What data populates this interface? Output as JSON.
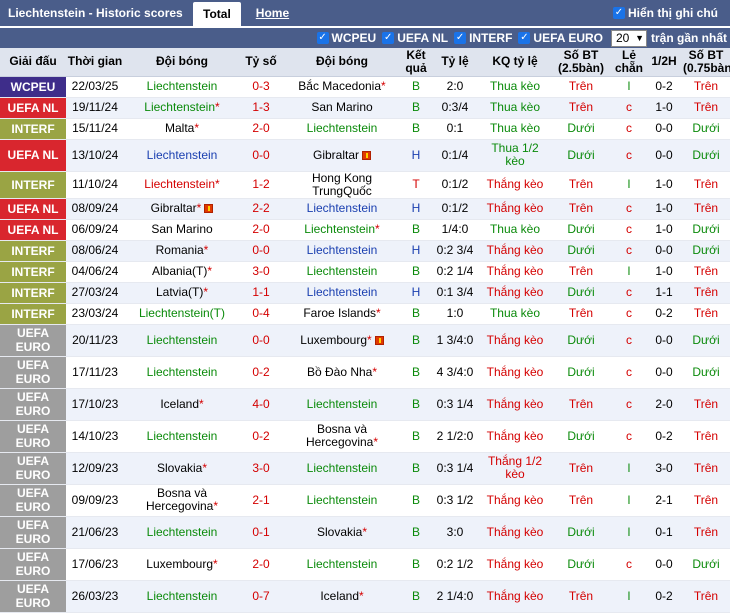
{
  "header": {
    "title": "Liechtenstein - Historic scores",
    "tab_total": "Total",
    "tab_home": "Home",
    "show_recent": "Hiển thị ghi chú"
  },
  "filters": {
    "items": [
      "WCPEU",
      "UEFA NL",
      "INTERF",
      "UEFA EURO"
    ],
    "count_value": "20",
    "recent_label": "trận gần nhất"
  },
  "columns": [
    "Giải đấu",
    "Thời gian",
    "Đội bóng",
    "Tỷ số",
    "Đội bóng",
    "Kết quả",
    "Tỷ lệ",
    "KQ tỷ lệ",
    "Số BT (2.5bàn)",
    "Lẻ chẵn",
    "1/2H",
    "Số BT (0.75bàn)"
  ],
  "colors": {
    "WCPEU": "#3e2d8a",
    "UEFA NL": "#d9262e",
    "INTERF": "#9aa444",
    "UEFA EURO": "#9e9e9e",
    "win": "#0a8a0a",
    "lose": "#d40000",
    "header_bg": "#4a5d8a"
  },
  "rows": [
    {
      "league": "WCPEU",
      "date": "22/03/25",
      "home": "Liechtenstein",
      "home_star": false,
      "home_color": "green",
      "score": "0-3",
      "away": "Bắc Macedonia",
      "away_star": true,
      "away_color": "black",
      "result": "B",
      "odds": "2:0",
      "odds_result": "Thua kèo",
      "ou": "Trên",
      "oe": "l",
      "half": "0-2",
      "ou2": "Trên"
    },
    {
      "league": "UEFA NL",
      "date": "19/11/24",
      "home": "Liechtenstein",
      "home_star": true,
      "home_color": "green",
      "score": "1-3",
      "away": "San Marino",
      "away_star": false,
      "away_color": "black",
      "result": "B",
      "odds": "0:3/4",
      "odds_result": "Thua kèo",
      "ou": "Trên",
      "oe": "c",
      "half": "1-0",
      "ou2": "Trên"
    },
    {
      "league": "INTERF",
      "date": "15/11/24",
      "home": "Malta",
      "home_star": true,
      "home_color": "black",
      "score": "2-0",
      "away": "Liechtenstein",
      "away_star": false,
      "away_color": "green",
      "result": "B",
      "odds": "0:1",
      "odds_result": "Thua kèo",
      "ou": "Dưới",
      "oe": "c",
      "half": "0-0",
      "ou2": "Dưới"
    },
    {
      "league": "UEFA NL",
      "date": "13/10/24",
      "home": "Liechtenstein",
      "home_star": false,
      "home_color": "blue",
      "score": "0-0",
      "away": "Gibraltar",
      "away_star": false,
      "away_flag": true,
      "away_color": "black",
      "result": "H",
      "odds": "0:1/4",
      "odds_result": "Thua 1/2 kèo",
      "ou": "Dưới",
      "oe": "c",
      "half": "0-0",
      "ou2": "Dưới"
    },
    {
      "league": "INTERF",
      "date": "11/10/24",
      "home": "Liechtenstein",
      "home_star": true,
      "home_color": "red",
      "score": "1-2",
      "away": "Hong Kong TrungQuốc",
      "away_star": false,
      "away_color": "black",
      "result": "T",
      "odds": "0:1/2",
      "odds_result": "Thắng kèo",
      "ou": "Trên",
      "oe": "l",
      "half": "1-0",
      "ou2": "Trên"
    },
    {
      "league": "UEFA NL",
      "date": "08/09/24",
      "home": "Gibraltar",
      "home_star": true,
      "home_flag": true,
      "home_color": "black",
      "score": "2-2",
      "away": "Liechtenstein",
      "away_star": false,
      "away_color": "blue",
      "result": "H",
      "odds": "0:1/2",
      "odds_result": "Thắng kèo",
      "ou": "Trên",
      "oe": "c",
      "half": "1-0",
      "ou2": "Trên"
    },
    {
      "league": "UEFA NL",
      "date": "06/09/24",
      "home": "San Marino",
      "home_star": false,
      "home_color": "black",
      "score": "2-0",
      "away": "Liechtenstein",
      "away_star": true,
      "away_color": "green",
      "result": "B",
      "odds": "1/4:0",
      "odds_result": "Thua kèo",
      "ou": "Dưới",
      "oe": "c",
      "half": "1-0",
      "ou2": "Dưới"
    },
    {
      "league": "INTERF",
      "date": "08/06/24",
      "home": "Romania",
      "home_star": true,
      "home_color": "black",
      "score": "0-0",
      "away": "Liechtenstein",
      "away_star": false,
      "away_color": "blue",
      "result": "H",
      "odds": "0:2 3/4",
      "odds_result": "Thắng kèo",
      "ou": "Dưới",
      "oe": "c",
      "half": "0-0",
      "ou2": "Dưới"
    },
    {
      "league": "INTERF",
      "date": "04/06/24",
      "home": "Albania(T)",
      "home_star": true,
      "home_color": "black",
      "score": "3-0",
      "away": "Liechtenstein",
      "away_star": false,
      "away_color": "green",
      "result": "B",
      "odds": "0:2 1/4",
      "odds_result": "Thắng kèo",
      "ou": "Trên",
      "oe": "l",
      "half": "1-0",
      "ou2": "Trên"
    },
    {
      "league": "INTERF",
      "date": "27/03/24",
      "home": "Latvia(T)",
      "home_star": true,
      "home_color": "black",
      "score": "1-1",
      "away": "Liechtenstein",
      "away_star": false,
      "away_color": "blue",
      "result": "H",
      "odds": "0:1 3/4",
      "odds_result": "Thắng kèo",
      "ou": "Dưới",
      "oe": "c",
      "half": "1-1",
      "ou2": "Trên"
    },
    {
      "league": "INTERF",
      "date": "23/03/24",
      "home": "Liechtenstein(T)",
      "home_star": false,
      "home_color": "green",
      "score": "0-4",
      "away": "Faroe Islands",
      "away_star": true,
      "away_color": "black",
      "result": "B",
      "odds": "1:0",
      "odds_result": "Thua kèo",
      "ou": "Trên",
      "oe": "c",
      "half": "0-2",
      "ou2": "Trên"
    },
    {
      "league": "UEFA EURO",
      "date": "20/11/23",
      "home": "Liechtenstein",
      "home_star": false,
      "home_color": "green",
      "score": "0-0",
      "away": "Luxembourg",
      "away_star": true,
      "away_flag": true,
      "away_color": "black",
      "result": "B",
      "odds": "1 3/4:0",
      "odds_result": "Thắng kèo",
      "ou": "Dưới",
      "oe": "c",
      "half": "0-0",
      "ou2": "Dưới"
    },
    {
      "league": "UEFA EURO",
      "date": "17/11/23",
      "home": "Liechtenstein",
      "home_star": false,
      "home_color": "green",
      "score": "0-2",
      "away": "Bồ Đào Nha",
      "away_star": true,
      "away_color": "black",
      "result": "B",
      "odds": "4 3/4:0",
      "odds_result": "Thắng kèo",
      "ou": "Dưới",
      "oe": "c",
      "half": "0-0",
      "ou2": "Dưới"
    },
    {
      "league": "UEFA EURO",
      "date": "17/10/23",
      "home": "Iceland",
      "home_star": true,
      "home_color": "black",
      "score": "4-0",
      "away": "Liechtenstein",
      "away_star": false,
      "away_color": "green",
      "result": "B",
      "odds": "0:3 1/4",
      "odds_result": "Thắng kèo",
      "ou": "Trên",
      "oe": "c",
      "half": "2-0",
      "ou2": "Trên"
    },
    {
      "league": "UEFA EURO",
      "date": "14/10/23",
      "home": "Liechtenstein",
      "home_star": false,
      "home_color": "green",
      "score": "0-2",
      "away": "Bosna và Hercegovina",
      "away_star": true,
      "away_color": "black",
      "result": "B",
      "odds": "2 1/2:0",
      "odds_result": "Thắng kèo",
      "ou": "Dưới",
      "oe": "c",
      "half": "0-2",
      "ou2": "Trên"
    },
    {
      "league": "UEFA EURO",
      "date": "12/09/23",
      "home": "Slovakia",
      "home_star": true,
      "home_color": "black",
      "score": "3-0",
      "away": "Liechtenstein",
      "away_star": false,
      "away_color": "green",
      "result": "B",
      "odds": "0:3 1/4",
      "odds_result": "Thắng 1/2 kèo",
      "ou": "Trên",
      "oe": "l",
      "half": "3-0",
      "ou2": "Trên"
    },
    {
      "league": "UEFA EURO",
      "date": "09/09/23",
      "home": "Bosna và Hercegovina",
      "home_star": true,
      "home_color": "black",
      "score": "2-1",
      "away": "Liechtenstein",
      "away_star": false,
      "away_color": "green",
      "result": "B",
      "odds": "0:3 1/2",
      "odds_result": "Thắng kèo",
      "ou": "Trên",
      "oe": "l",
      "half": "2-1",
      "ou2": "Trên"
    },
    {
      "league": "UEFA EURO",
      "date": "21/06/23",
      "home": "Liechtenstein",
      "home_star": false,
      "home_color": "green",
      "score": "0-1",
      "away": "Slovakia",
      "away_star": true,
      "away_color": "black",
      "result": "B",
      "odds": "3:0",
      "odds_result": "Thắng kèo",
      "ou": "Dưới",
      "oe": "l",
      "half": "0-1",
      "ou2": "Trên"
    },
    {
      "league": "UEFA EURO",
      "date": "17/06/23",
      "home": "Luxembourg",
      "home_star": true,
      "home_color": "black",
      "score": "2-0",
      "away": "Liechtenstein",
      "away_star": false,
      "away_color": "green",
      "result": "B",
      "odds": "0:2 1/2",
      "odds_result": "Thắng kèo",
      "ou": "Dưới",
      "oe": "c",
      "half": "0-0",
      "ou2": "Dưới"
    },
    {
      "league": "UEFA EURO",
      "date": "26/03/23",
      "home": "Liechtenstein",
      "home_star": false,
      "home_color": "green",
      "score": "0-7",
      "away": "Iceland",
      "away_star": true,
      "away_color": "black",
      "result": "B",
      "odds": "2 1/4:0",
      "odds_result": "Thắng kèo",
      "ou": "Trên",
      "oe": "l",
      "half": "0-2",
      "ou2": "Trên"
    }
  ]
}
